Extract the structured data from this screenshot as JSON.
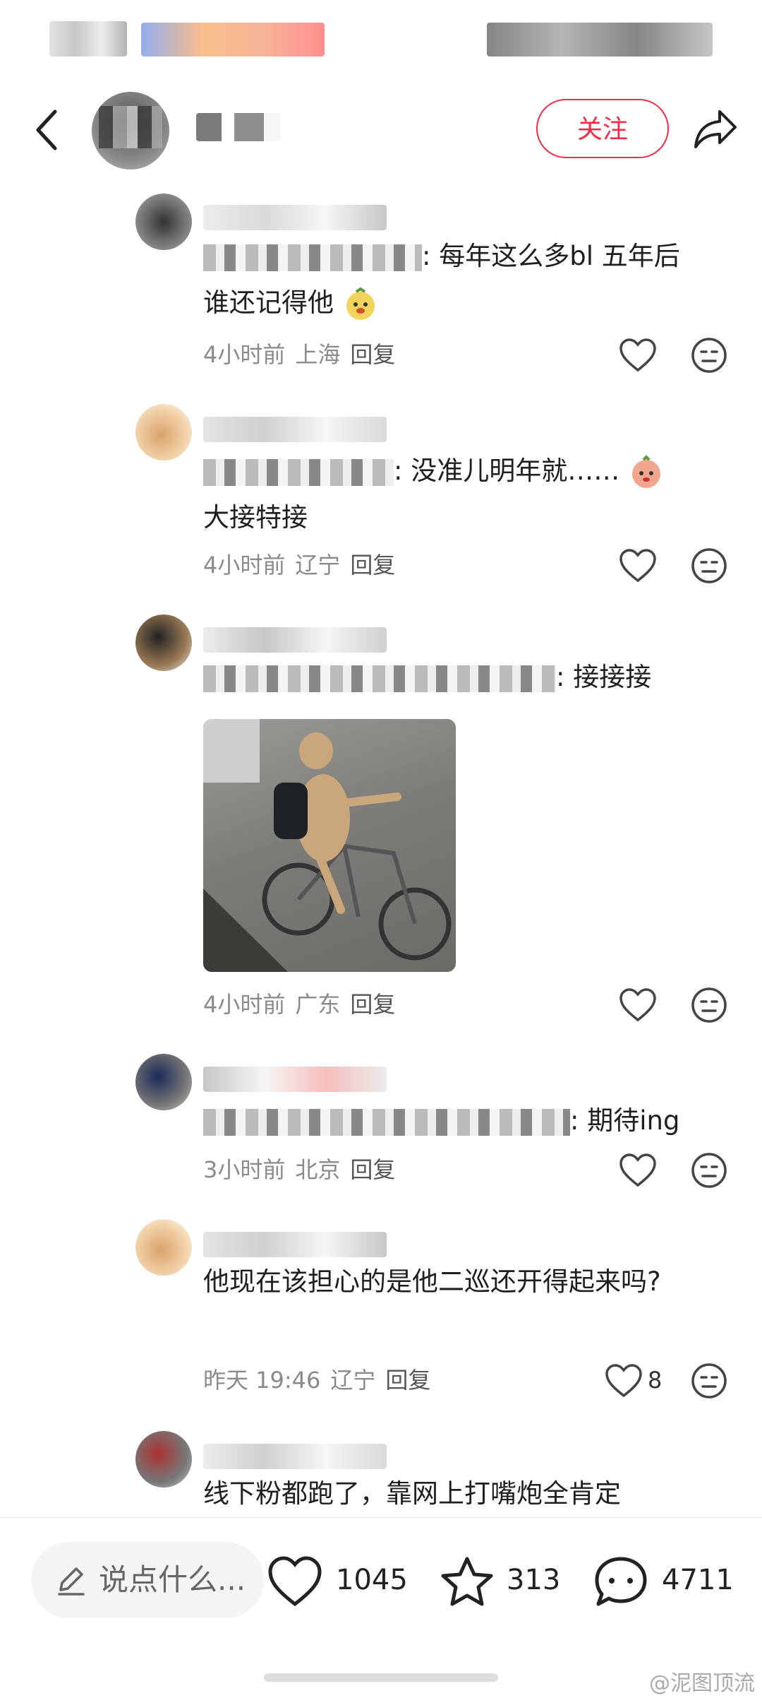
{
  "header": {
    "follow_label": "关注"
  },
  "comments": [
    {
      "text_mask": "回复 ·············",
      "text": ": 每年这么多bl 五年后谁还记得他",
      "time": "4小时前",
      "location": "上海",
      "reply": "回复"
    },
    {
      "text_mask": "回复 ·········",
      "text": ": 没准儿明年就……",
      "text2": "大接特接",
      "time": "4小时前",
      "location": "辽宁",
      "reply": "回复"
    },
    {
      "text_mask": "回复 ·················",
      "text": ": 接接接",
      "time": "4小时前",
      "location": "广东",
      "reply": "回复"
    },
    {
      "text_mask": "回复 ··················",
      "text": ": 期待ing",
      "time": "3小时前",
      "location": "北京",
      "reply": "回复"
    },
    {
      "text": "他现在该担心的是他二巡还开得起来吗?",
      "time": "昨天 19:46",
      "location": "辽宁",
      "reply": "回复",
      "likes": "8"
    },
    {
      "text": "线下粉都跑了，靠网上打嘴炮全肯定"
    }
  ],
  "bottom": {
    "input_placeholder": "说点什么...",
    "likes": "1045",
    "favorites": "313",
    "comments": "4711"
  },
  "watermark": "@泥图顶流",
  "icons": [
    "back-arrow-icon",
    "share-icon",
    "heart-icon",
    "emoji-icon",
    "star-icon",
    "chat-bubble-icon",
    "pencil-icon"
  ]
}
